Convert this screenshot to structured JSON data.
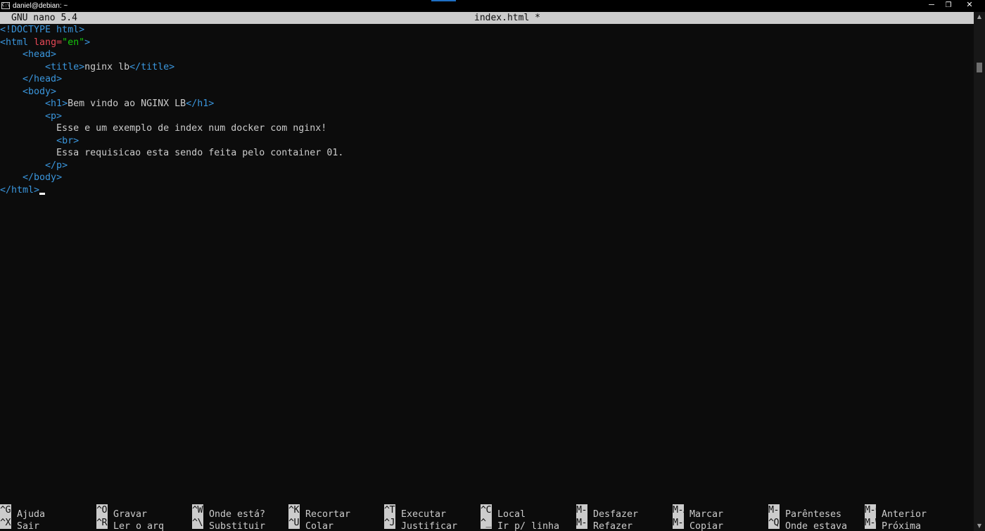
{
  "window": {
    "title": "daniel@debian: ~",
    "icon_label": "C:\\",
    "controls": {
      "minimize": "─",
      "maximize": "❐",
      "close": "✕"
    }
  },
  "nano": {
    "version": "GNU nano 5.4",
    "filename": "index.html *"
  },
  "code": [
    [
      {
        "t": "tag",
        "v": "<!DOCTYPE html>"
      }
    ],
    [
      {
        "t": "tag",
        "v": "<html "
      },
      {
        "t": "attr",
        "v": "lang="
      },
      {
        "t": "str",
        "v": "\"en\""
      },
      {
        "t": "tag",
        "v": ">"
      }
    ],
    [
      {
        "t": "txt",
        "v": "    "
      },
      {
        "t": "tag",
        "v": "<head>"
      }
    ],
    [
      {
        "t": "txt",
        "v": "        "
      },
      {
        "t": "tag",
        "v": "<title>"
      },
      {
        "t": "txt",
        "v": "nginx lb"
      },
      {
        "t": "tag",
        "v": "</title>"
      }
    ],
    [
      {
        "t": "txt",
        "v": "    "
      },
      {
        "t": "tag",
        "v": "</head>"
      }
    ],
    [
      {
        "t": "txt",
        "v": "    "
      },
      {
        "t": "tag",
        "v": "<body>"
      }
    ],
    [
      {
        "t": "txt",
        "v": "        "
      },
      {
        "t": "tag",
        "v": "<h1>"
      },
      {
        "t": "txt",
        "v": "Bem vindo ao NGINX LB"
      },
      {
        "t": "tag",
        "v": "</h1>"
      }
    ],
    [
      {
        "t": "txt",
        "v": "        "
      },
      {
        "t": "tag",
        "v": "<p>"
      }
    ],
    [
      {
        "t": "txt",
        "v": "          Esse e um exemplo de index num docker com nginx!"
      }
    ],
    [
      {
        "t": "txt",
        "v": "          "
      },
      {
        "t": "tag",
        "v": "<br>"
      }
    ],
    [
      {
        "t": "txt",
        "v": "          Essa requisicao esta sendo feita pelo container 01."
      }
    ],
    [
      {
        "t": "txt",
        "v": "        "
      },
      {
        "t": "tag",
        "v": "</p>"
      }
    ],
    [
      {
        "t": "txt",
        "v": "    "
      },
      {
        "t": "tag",
        "v": "</body>"
      }
    ],
    [
      {
        "t": "tag",
        "v": "</html>"
      }
    ]
  ],
  "shortcuts": [
    [
      {
        "key": "^G",
        "label": "Ajuda"
      },
      {
        "key": "^X",
        "label": "Sair"
      }
    ],
    [
      {
        "key": "^O",
        "label": "Gravar"
      },
      {
        "key": "^R",
        "label": "Ler o arq"
      }
    ],
    [
      {
        "key": "^W",
        "label": "Onde está?"
      },
      {
        "key": "^\\",
        "label": "Substituir"
      }
    ],
    [
      {
        "key": "^K",
        "label": "Recortar"
      },
      {
        "key": "^U",
        "label": "Colar"
      }
    ],
    [
      {
        "key": "^T",
        "label": "Executar"
      },
      {
        "key": "^J",
        "label": "Justificar"
      }
    ],
    [
      {
        "key": "^C",
        "label": "Local"
      },
      {
        "key": "^_",
        "label": "Ir p/ linha"
      }
    ],
    [
      {
        "key": "M-U",
        "label": "Desfazer"
      },
      {
        "key": "M-E",
        "label": "Refazer"
      }
    ],
    [
      {
        "key": "M-A",
        "label": "Marcar"
      },
      {
        "key": "M-6",
        "label": "Copiar"
      }
    ],
    [
      {
        "key": "M-]",
        "label": "Parênteses"
      },
      {
        "key": "^Q",
        "label": "Onde estava"
      }
    ],
    [
      {
        "key": "M-Q",
        "label": "Anterior"
      },
      {
        "key": "M-W",
        "label": "Próxima"
      }
    ]
  ]
}
